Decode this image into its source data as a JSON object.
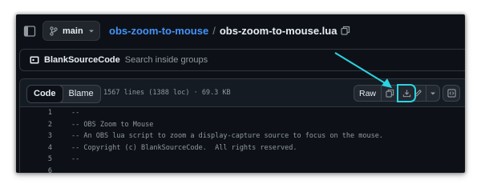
{
  "branch": {
    "name": "main"
  },
  "breadcrumb": {
    "repo": "obs-zoom-to-mouse",
    "separator": "/",
    "file": "obs-zoom-to-mouse.lua"
  },
  "commit_bar": {
    "author": "BlankSourceCode",
    "message": "Search inside groups"
  },
  "file_header": {
    "tabs": [
      "Code",
      "Blame"
    ],
    "active_tab": "Code",
    "meta": "1567 lines (1388 loc) · 69.3 KB",
    "raw_label": "Raw"
  },
  "code_lines": [
    {
      "num": "1",
      "text": "--"
    },
    {
      "num": "2",
      "text": "-- OBS Zoom to Mouse"
    },
    {
      "num": "3",
      "text": "-- An OBS lua script to zoom a display-capture source to focus on the mouse."
    },
    {
      "num": "4",
      "text": "-- Copyright (c) BlankSourceCode.  All rights reserved."
    },
    {
      "num": "5",
      "text": "--"
    },
    {
      "num": "6",
      "text": ""
    }
  ],
  "annotation": {
    "color": "#2cd3e0",
    "target": "download-raw-file-button"
  },
  "colors": {
    "background": "#0d1117",
    "link": "#4493f8",
    "border": "#30363d",
    "text": "#e6edf3",
    "muted": "#9198a1"
  }
}
